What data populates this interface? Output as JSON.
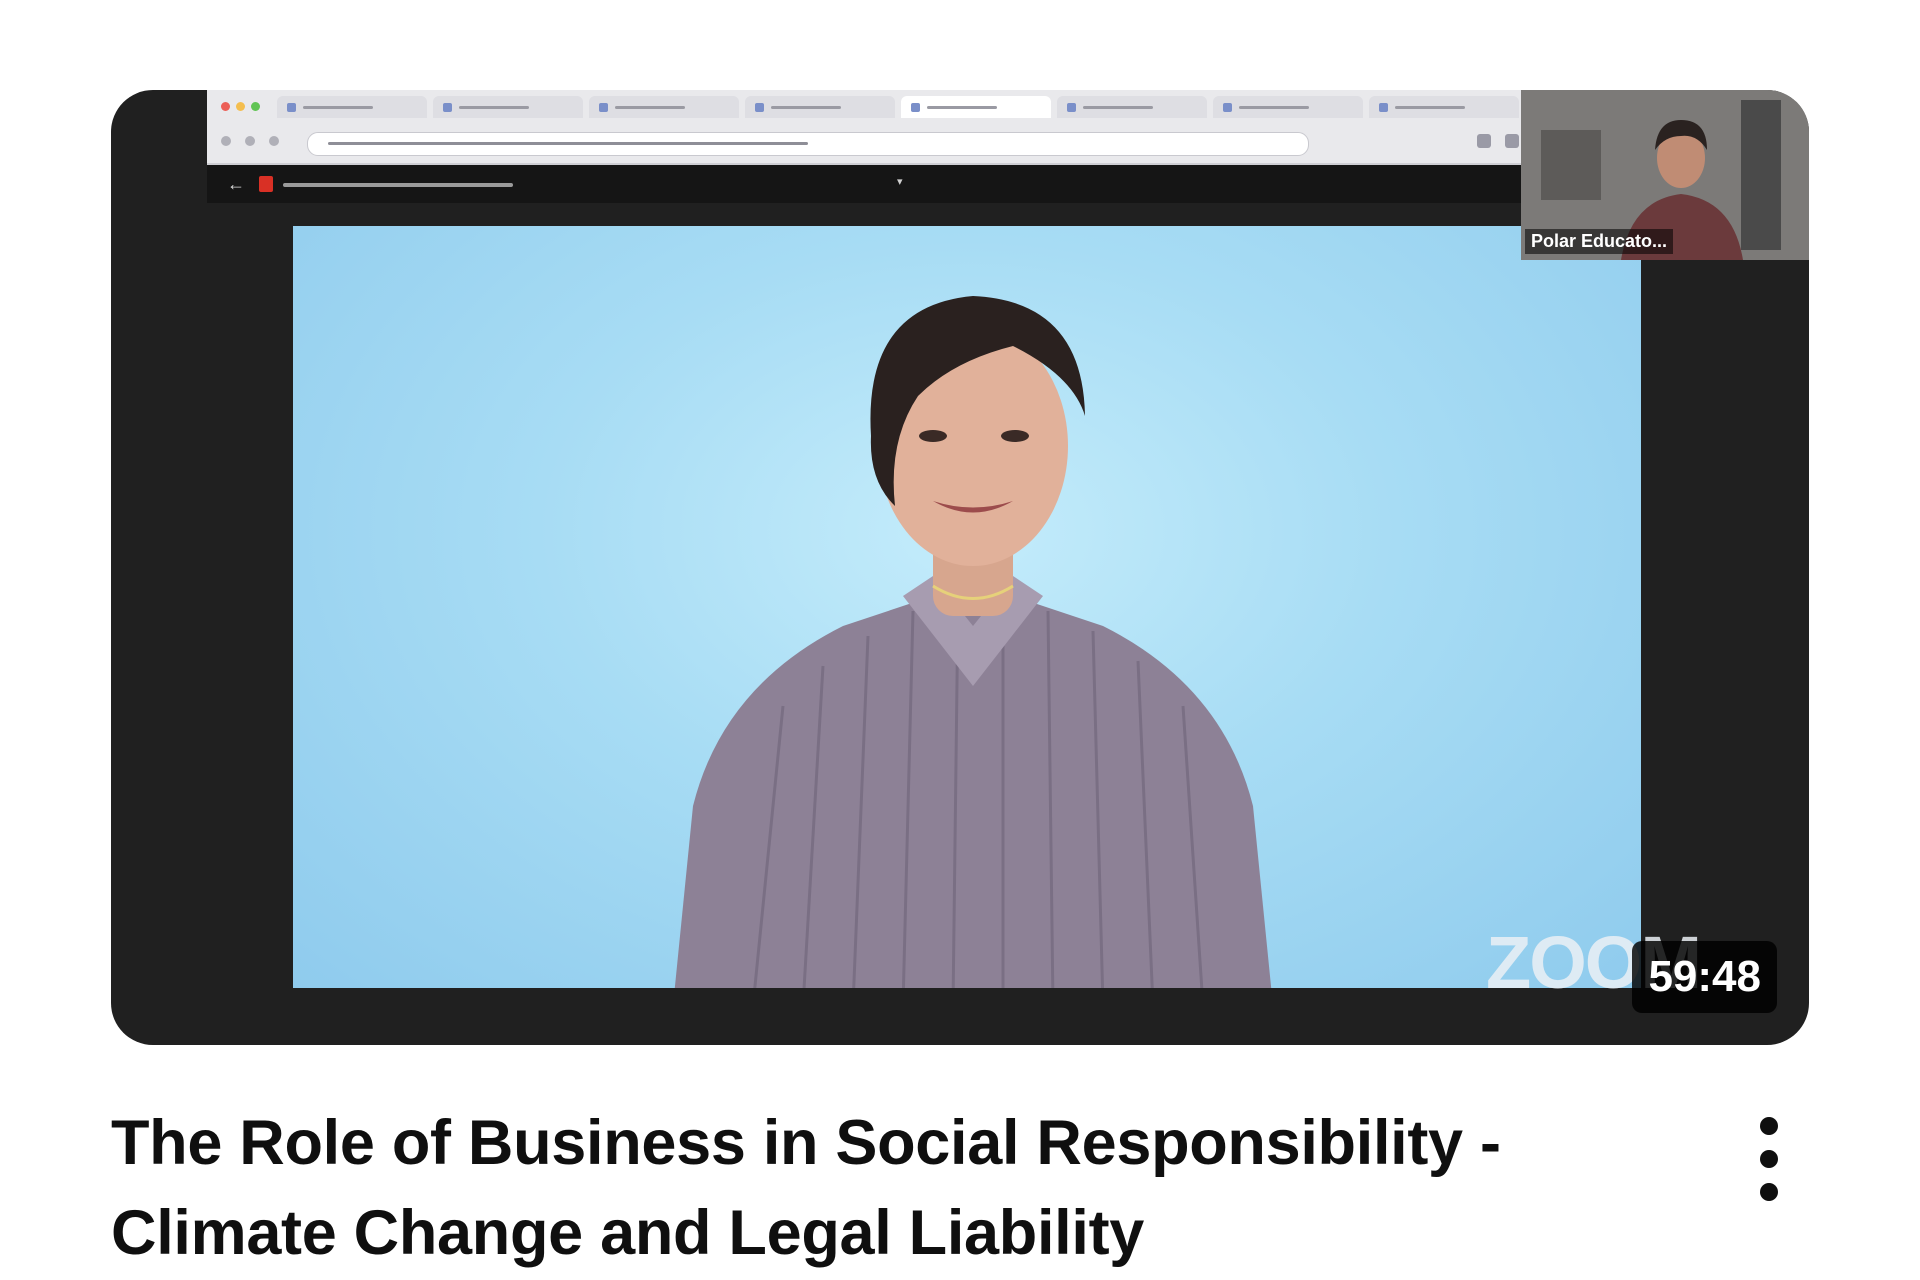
{
  "video": {
    "title": "The Role of Business in Social Responsibility - Climate Change and Legal Liability",
    "duration": "59:48",
    "participant_name": "Polar Educato..."
  },
  "icons": {
    "menu": "more-vert-icon"
  },
  "colors": {
    "card_background": "#202020",
    "stage_background": "#a7dcf4",
    "title_text": "#0f0f0f",
    "duration_badge": "#000000"
  }
}
